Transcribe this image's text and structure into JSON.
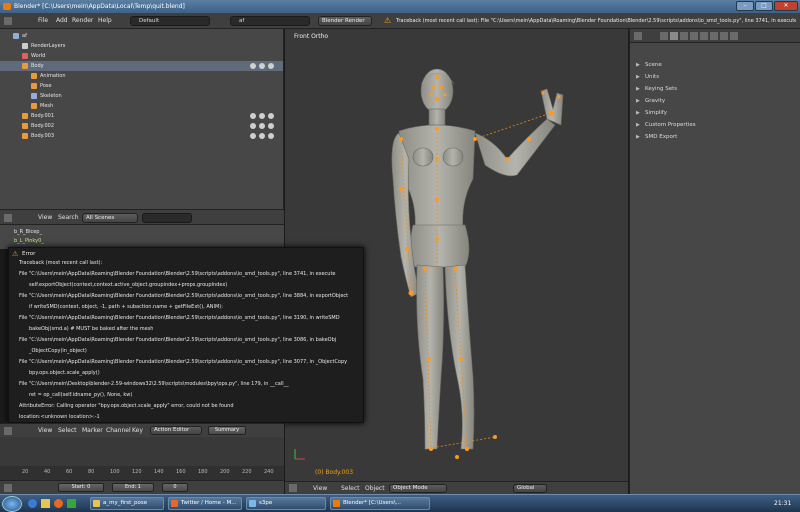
{
  "window": {
    "title": "Blender* [C:\\Users\\mein\\AppData\\Local\\Temp\\quit.blend]",
    "buttons": [
      "–",
      "□",
      "✕"
    ]
  },
  "info_header": {
    "menus": [
      "File",
      "Add",
      "Render",
      "Help"
    ],
    "screen_layout": "Default",
    "scene": "af",
    "render_engine": "Blender Render",
    "report": "Traceback (most recent call last): File \"C:\\Users\\mein\\AppData\\Roaming\\Blender Foundation\\Blender\\2.59\\scripts\\addons\\io_smd_tools.py\", line 3741, in execute"
  },
  "outliner": {
    "rows": [
      {
        "label": "af",
        "indent": 1,
        "color": "#8fb0d6"
      },
      {
        "label": "RenderLayers",
        "indent": 2,
        "color": "#ccc"
      },
      {
        "label": "World",
        "indent": 2,
        "color": "#e06060"
      },
      {
        "label": "Body",
        "indent": 2,
        "color": "#e89a3c",
        "selected": true
      },
      {
        "label": "Animation",
        "indent": 3,
        "color": "#e89a3c"
      },
      {
        "label": "Pose",
        "indent": 3,
        "color": "#e89a3c"
      },
      {
        "label": "Skeleton",
        "indent": 3,
        "color": "#9ad"
      },
      {
        "label": "Mesh",
        "indent": 3,
        "color": "#e89a3c"
      },
      {
        "label": "Body.001",
        "indent": 2,
        "color": "#e89a3c"
      },
      {
        "label": "Body.002",
        "indent": 2,
        "color": "#e89a3c"
      },
      {
        "label": "Body.003",
        "indent": 2,
        "color": "#e89a3c"
      }
    ],
    "header": {
      "view": "View",
      "search": "Search",
      "filter": "All Scenes"
    },
    "lower_rows": [
      "b_R_Bicep_",
      "b_L_Pinky0_"
    ]
  },
  "error": {
    "title": "Error",
    "lines": [
      "Traceback (most recent call last):",
      "File \"C:\\Users\\mein\\AppData\\Roaming\\Blender Foundation\\Blender\\2.59\\scripts\\addons\\io_smd_tools.py\", line 3741, in execute",
      "self.exportObject(context,context.active_object.groupindex+props.groupIndex)",
      "File \"C:\\Users\\mein\\AppData\\Roaming\\Blender Foundation\\Blender\\2.59\\scripts\\addons\\io_smd_tools.py\", line 3884, in exportObject",
      "if writeSMD(context, object, -1, path + subaction.name + getFileExt(), ANIM):",
      "File \"C:\\Users\\mein\\AppData\\Roaming\\Blender Foundation\\Blender\\2.59\\scripts\\addons\\io_smd_tools.py\", line 3190, in writeSMD",
      "bakeObj(smd.a) # MUST be baked after the mesh",
      "File \"C:\\Users\\mein\\AppData\\Roaming\\Blender Foundation\\Blender\\2.59\\scripts\\addons\\io_smd_tools.py\", line 3086, in bakeObj",
      "_ObjectCopy(in_object)",
      "File \"C:\\Users\\mein\\AppData\\Roaming\\Blender Foundation\\Blender\\2.59\\scripts\\addons\\io_smd_tools.py\", line 3077, in _ObjectCopy",
      "bpy.ops.object.scale_apply()",
      "File \"C:\\Users\\mein\\Desktop\\blender-2.59-windows32\\2.59\\scripts\\modules\\bpy\\ops.py\", line 179, in __call__",
      "ret = op_call(self.idname_py(), None, kw)",
      "AttributeError: Calling operator \"bpy.ops.object.scale_apply\" error, could not be found",
      "location:<unknown location>:-1"
    ]
  },
  "dopesheet": {
    "menus": [
      "View",
      "Select",
      "Marker",
      "Channel",
      "Key"
    ],
    "mode": "Action Editor",
    "summary": "Summary",
    "ticks": [
      "20",
      "40",
      "60",
      "80",
      "100",
      "120",
      "140",
      "160",
      "180",
      "200",
      "220",
      "240"
    ]
  },
  "timeline_bar": {
    "start": "Start: 0",
    "end": "End: 1",
    "current": "0"
  },
  "viewport": {
    "view_label": "Front Ortho",
    "object_label": "(0) Body.003",
    "menus": [
      "View",
      "Select",
      "Object"
    ],
    "mode": "Object Mode",
    "orientation": "Global"
  },
  "properties": {
    "panels": [
      "Scene",
      "Units",
      "Keying Sets",
      "Gravity",
      "Simplify",
      "Custom Properties",
      "SMD Export"
    ]
  },
  "taskbar": {
    "tasks": [
      {
        "label": "a_my_first_pose",
        "color": "#e8c454"
      },
      {
        "label": "Twitter / Home - M...",
        "color": "#e8682c"
      },
      {
        "label": "s3pe",
        "color": "#7ab8e8"
      },
      {
        "label": "Blender* [C:\\Users\\...",
        "color": "#e87d0d"
      }
    ],
    "clock": "21:31"
  }
}
